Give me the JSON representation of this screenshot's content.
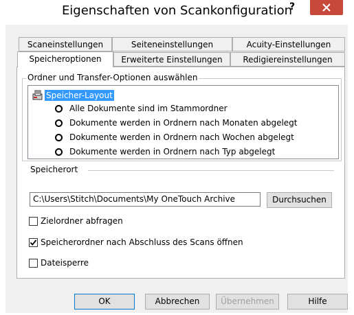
{
  "window": {
    "title": "Eigenschaften von Scankonfiguration",
    "help_label": "?",
    "close_label": "×"
  },
  "tabs": {
    "row1": [
      {
        "label": "Scaneinstellungen"
      },
      {
        "label": "Seiteneinstellungen"
      },
      {
        "label": "Acuity-Einstellungen"
      }
    ],
    "row2": [
      {
        "label": "Speicheroptionen",
        "active": true
      },
      {
        "label": "Erweiterte Einstellungen"
      },
      {
        "label": "Redigiereinstellungen"
      }
    ]
  },
  "group": {
    "label": "Ordner und Transfer-Optionen auswählen",
    "tree_root": "Speicher-Layout",
    "options": [
      "Alle Dokumente sind im Stammordner",
      "Dokumente werden in Ordnern nach Monaten abgelegt",
      "Dokumente werden in Ordnern nach Wochen abgelegt",
      "Dokumente werden in Ordnern nach Typ abgelegt"
    ]
  },
  "storage": {
    "label": "Speicherort",
    "path": "C:\\Users\\Stitch\\Documents\\My OneTouch Archive",
    "browse_label": "Durchsuchen"
  },
  "checkboxes": [
    {
      "label": "Zielordner abfragen",
      "checked": false
    },
    {
      "label": "Speicherordner nach Abschluss des Scans öffnen",
      "checked": true
    },
    {
      "label": "Dateisperre",
      "checked": false
    }
  ],
  "buttons": {
    "ok": "OK",
    "cancel": "Abbrechen",
    "apply": "Übernehmen",
    "help": "Hilfe"
  },
  "colors": {
    "close_button": "#c7493b",
    "selection": "#3399ff",
    "dialog_bg": "#f0f0f0"
  }
}
